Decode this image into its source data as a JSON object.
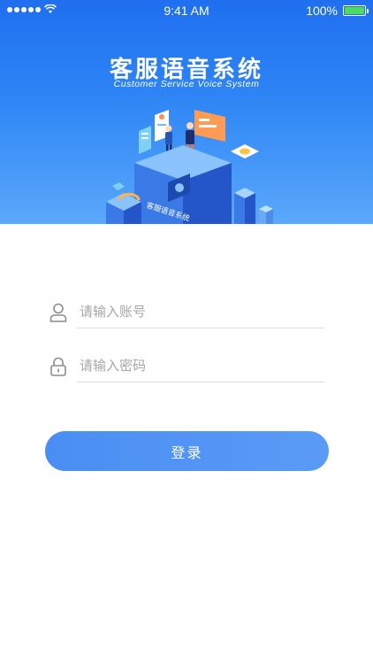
{
  "status_bar": {
    "time": "9:41 AM",
    "battery": "100%",
    "battery_level": 1.0
  },
  "hero": {
    "title": "客服语音系统",
    "subtitle": "Customer Service Voice System",
    "illustration_caption": "客服语音系统",
    "colors": {
      "top": "#1f6ff0",
      "bottom": "#5aa8fb"
    }
  },
  "login_form": {
    "account_placeholder": "请输入账号",
    "account_icon": "user-icon",
    "password_placeholder": "请输入密码",
    "password_icon": "lock-icon",
    "submit_label": "登录",
    "accent_color": "#4a8ef4"
  }
}
